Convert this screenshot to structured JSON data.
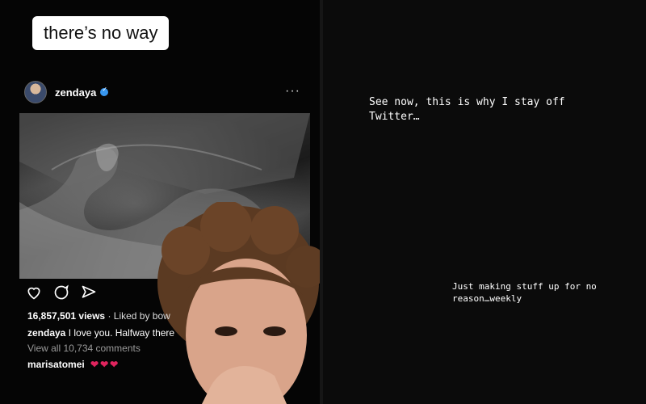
{
  "left_panel": {
    "caption": "there’s no way",
    "post": {
      "username": "zendaya",
      "more": "···",
      "views": "16,857,501 views",
      "liked_by": "· Liked by bow",
      "caption_user": "zendaya",
      "caption_text": "I love you. Halfway there",
      "comments_link": "View all 10,734 comments",
      "commenter": "marisatomei",
      "commenter_hearts": "❤❤❤"
    }
  },
  "right_panel": {
    "story_text_1": "See now, this is why I stay off Twitter…",
    "story_text_2": "Just making stuff up for no reason…weekly"
  },
  "colors": {
    "verified": "#3897f0",
    "heart": "#e0245e"
  },
  "icons": [
    "more-icon",
    "verified-icon",
    "heart-icon",
    "comment-icon",
    "share-icon"
  ]
}
